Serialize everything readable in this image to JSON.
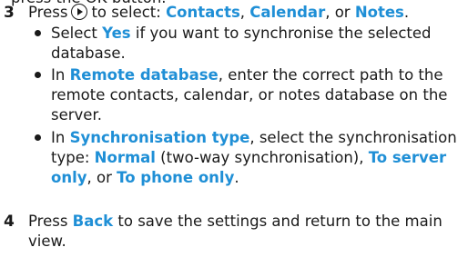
{
  "cut_text": "press the OK button.",
  "step3": {
    "number": "3",
    "press": "Press",
    "key_icon": "select-key-icon",
    "to_select": "to select: ",
    "opt_contacts": "Contacts",
    "comma1": ", ",
    "opt_calendar": "Calendar",
    "or": ", or ",
    "opt_notes": "Notes",
    "period": "."
  },
  "bullets": [
    {
      "l1_a": "Select ",
      "l1_b": "Yes",
      "l1_c": " if you want to synchronise the selected",
      "l2": "database."
    },
    {
      "l1_a": "In ",
      "l1_b": "Remote database",
      "l1_c": ", enter the correct path to the",
      "l2": "remote contacts, calendar, or notes database on the",
      "l3": "server."
    },
    {
      "l1_a": "In ",
      "l1_b": "Synchronisation type",
      "l1_c": ", select the synchronisation",
      "l2_a": "type: ",
      "l2_b": "Normal",
      "l2_c": " (two-way synchronisation), ",
      "l2_d": "To server",
      "l3_a": "only",
      "l3_b": ", or ",
      "l3_c": "To phone only",
      "l3_d": "."
    }
  ],
  "step4": {
    "number": "4",
    "a": "Press ",
    "b": "Back",
    "c": " to save the settings and return to the main",
    "l2": "view."
  },
  "colors": {
    "highlight": "#1f8fd6",
    "text": "#1a1a1a",
    "background": "#ffffff"
  }
}
